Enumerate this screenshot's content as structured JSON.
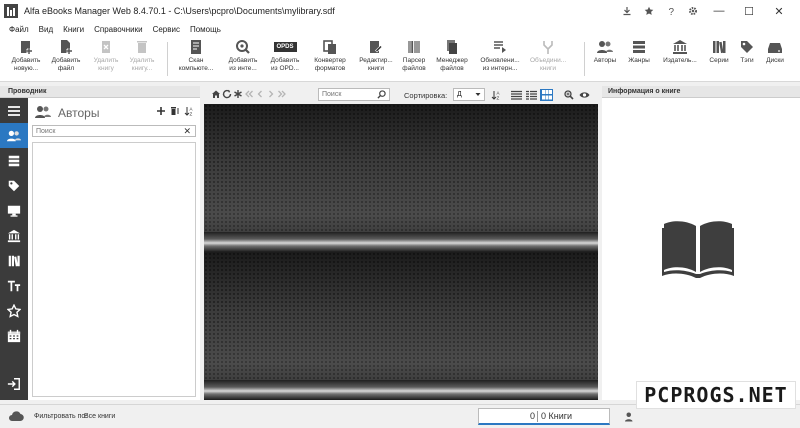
{
  "window": {
    "title": "Alfa eBooks Manager Web 8.4.70.1 - C:\\Users\\pcpro\\Documents\\mylibrary.sdf",
    "title_icons": [
      "download-icon",
      "star-icon",
      "help-icon",
      "gear-icon"
    ],
    "controls": [
      "—",
      "☐",
      "✕"
    ]
  },
  "menu": [
    "Файл",
    "Вид",
    "Книги",
    "Справочники",
    "Сервис",
    "Помощь"
  ],
  "toolbar": {
    "add_new": "Добавить новую...",
    "add_file": "Добавить файл",
    "delete_book": "Удалить книгу",
    "delete_books": "Удалить книгу...",
    "scan": "Скан компьюте...",
    "add_from_internet": "Добавить из инте...",
    "add_from_opds": "Добавить из OPD...",
    "opds_badge": "OPDS",
    "convert": "Конвертер форматов",
    "editor": "Редактир... книги",
    "parser": "Парсер файлов",
    "file_manager": "Менеджер файлов",
    "update_internet": "Обновлени... из интерн...",
    "merge": "Объедини... книги",
    "authors": "Авторы",
    "genres": "Жанры",
    "publishers": "Издатель...",
    "series": "Серии",
    "tags": "Тэги",
    "disks": "Диски"
  },
  "explorer": {
    "header": "Проводник",
    "section_title": "Авторы",
    "search_placeholder": "Поиск",
    "clear": "✕"
  },
  "center": {
    "search_placeholder": "Поиск",
    "sort_label": "Сортировка:",
    "sort_value": "Д"
  },
  "info": {
    "header": "Информация о книге"
  },
  "status": {
    "filter_label": "Фильтровать по:",
    "filter_value": "Все книги",
    "count": "0",
    "count_label": "0 Книги"
  },
  "watermark": "PCPROGS.NET",
  "colors": {
    "accent": "#2b78c2",
    "rail": "#3b3b3b",
    "shelf": "#3c3c3c"
  }
}
